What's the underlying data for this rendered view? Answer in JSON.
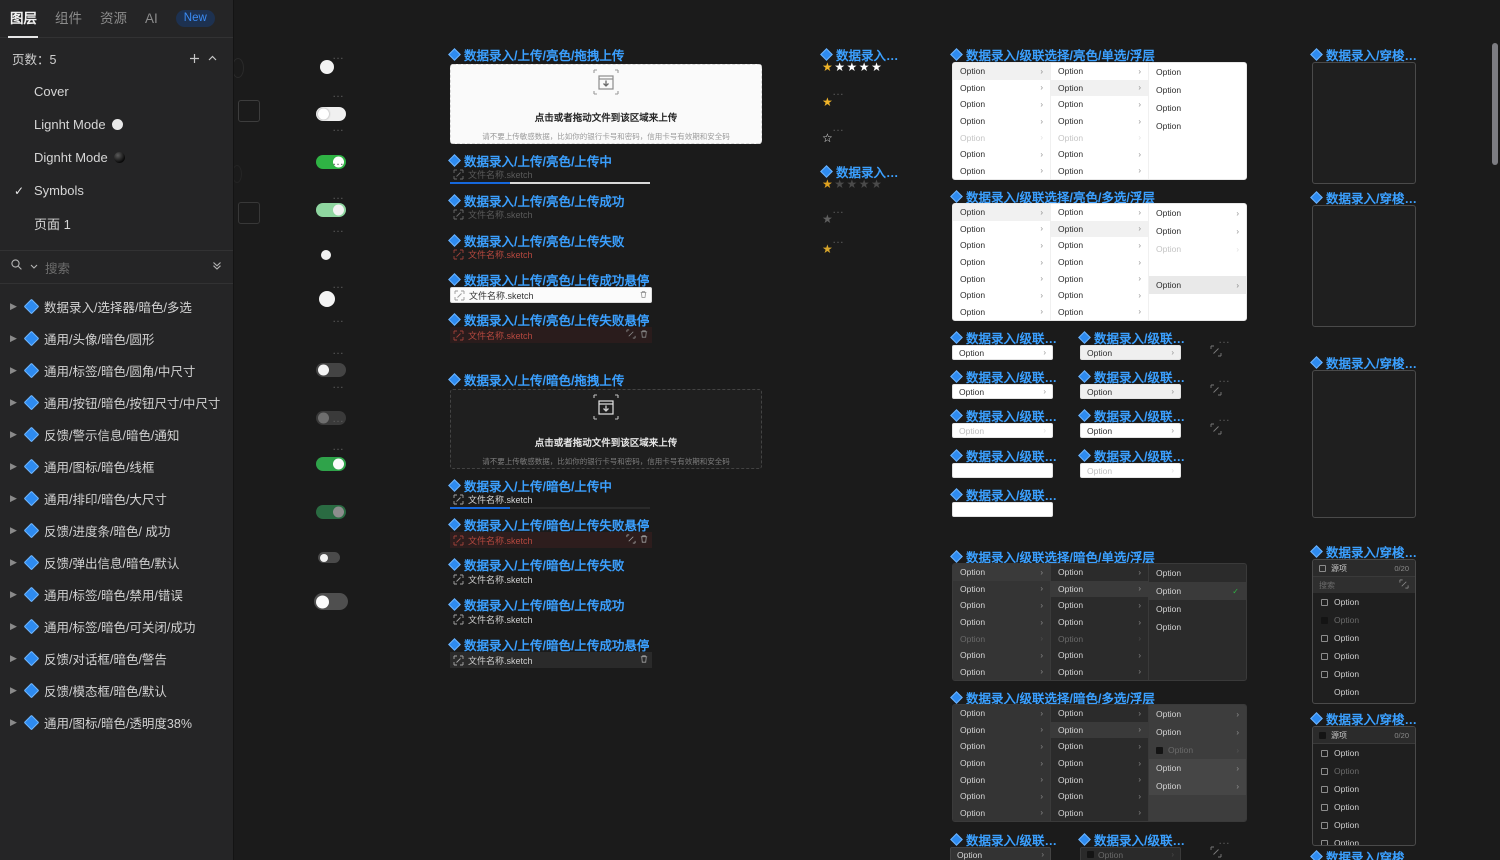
{
  "sidebar": {
    "tabs": [
      {
        "label": "图层",
        "active": true
      },
      {
        "label": "组件",
        "active": false
      },
      {
        "label": "资源",
        "active": false
      },
      {
        "label": "AI",
        "active": false
      }
    ],
    "badge_new": "New",
    "pages_label": "页数：5",
    "add_icon": "plus-icon",
    "collapse_icon": "chevron-up-icon",
    "pages": [
      {
        "label": "Cover",
        "checked": false,
        "dot": ""
      },
      {
        "label": "Lignht Mode",
        "checked": false,
        "dot": "light"
      },
      {
        "label": "Dignht Mode",
        "checked": false,
        "dot": "dark"
      },
      {
        "label": "Symbols",
        "checked": true,
        "dot": ""
      },
      {
        "label": "页面 1",
        "checked": false,
        "dot": ""
      }
    ],
    "search": {
      "placeholder": "搜索",
      "icon": "search-icon",
      "filter_icon": "chevron-down-icon",
      "expand_icon": "double-chevron-down-icon"
    },
    "symbols": [
      "数据录入/选择器/暗色/多选",
      "通用/头像/暗色/圆形",
      "通用/标签/暗色/圆角/中尺寸",
      "通用/按钮/暗色/按钮尺寸/中尺寸",
      "反馈/警示信息/暗色/通知",
      "通用/图标/暗色/线框",
      "通用/排印/暗色/大尺寸",
      "反馈/进度条/暗色/ 成功",
      "反馈/弹出信息/暗色/默认",
      "通用/标签/暗色/禁用/错误",
      "通用/标签/暗色/可关闭/成功",
      "反馈/对话框/暗色/警告",
      "反馈/模态框/暗色/默认",
      "通用/图标/暗色/透明度38%"
    ]
  },
  "canvas": {
    "colors": {
      "title_blue": "#3ba0ff",
      "accent_blue": "#1668dc",
      "success_green": "#2fb344",
      "error_red": "#c4443a",
      "star_gold": "#f0b429"
    },
    "toggles": [
      {
        "state": "off-light",
        "dots": "…"
      },
      {
        "state": "off-light-wide",
        "dots": "…"
      },
      {
        "state": "on-green",
        "dots": "…"
      },
      {
        "state": "on-green-dim",
        "dots": "…"
      },
      {
        "state": "off-small",
        "dots": "…"
      },
      {
        "state": "off-plain",
        "dots": "…"
      },
      {
        "state": "off-dark",
        "dots": "…"
      },
      {
        "state": "off-dark-dim",
        "dots": "…"
      },
      {
        "state": "on-dark-green",
        "dots": "…"
      },
      {
        "state": "on-dark-green-dim",
        "dots": "…"
      },
      {
        "state": "off-dark-small",
        "dots": "…"
      },
      {
        "state": "off-dark-wide",
        "dots": "…"
      }
    ],
    "upload_light": {
      "group_titles": [
        "数据录入/上传/亮色/拖拽上传",
        "数据录入/上传/亮色/上传中",
        "数据录入/上传/亮色/上传成功",
        "数据录入/上传/亮色/上传失败",
        "数据录入/上传/亮色/上传成功悬停",
        "数据录入/上传/亮色/上传失败悬停"
      ],
      "drop_icon": "upload-box-icon",
      "drop_main": "点击或者拖动文件到该区域来上传",
      "drop_sub": "请不要上传敏感数据，比如你的银行卡号和密码，信用卡号有效期和安全码",
      "file_name": "文件名称.sketch",
      "progress_percent": 30,
      "delete_icon": "trash-icon",
      "retry_icon": "retry-icon"
    },
    "upload_dark": {
      "group_titles": [
        "数据录入/上传/暗色/拖拽上传",
        "数据录入/上传/暗色/上传中",
        "数据录入/上传/暗色/上传失败悬停",
        "数据录入/上传/暗色/上传失败",
        "数据录入/上传/暗色/上传成功",
        "数据录入/上传/暗色/上传成功悬停"
      ],
      "drop_icon": "upload-box-icon",
      "drop_main": "点击或者拖动文件到该区域来上传",
      "drop_sub": "请不要上传敏感数据，比如你的银行卡号和密码，信用卡号有效期和安全码",
      "file_name": "文件名称.sketch",
      "progress_percent": 30,
      "delete_icon": "trash-icon",
      "retry_icon": "retry-icon"
    },
    "rates": [
      {
        "title": "数据录入…",
        "filled": 1,
        "total": 5,
        "style": "bright",
        "sub": [
          {
            "dots": "…",
            "icon": "star-gold-icon"
          },
          {
            "dots": "…",
            "icon": "star-outline-icon"
          }
        ]
      },
      {
        "title": "数据录入…",
        "filled": 1,
        "total": 5,
        "style": "dim",
        "sub": [
          {
            "dots": "…",
            "icon": "star-dim-icon"
          },
          {
            "dots": "…",
            "icon": "star-gold-icon"
          }
        ]
      }
    ],
    "cascaders": [
      {
        "title": "数据录入/级联选择/亮色/单选/浮层",
        "theme": "light"
      },
      {
        "title": "数据录入/级联选择/亮色/多选/浮层",
        "theme": "light"
      },
      {
        "title": "数据录入/级联选择/暗色/单选/浮层",
        "theme": "dark"
      },
      {
        "title": "数据录入/级联选择/暗色/多选/浮层",
        "theme": "dark"
      }
    ],
    "cascader_option": "Option",
    "small_cascaders_light": [
      {
        "title": "数据录入/级联…",
        "value": "Option",
        "variant": "light"
      },
      {
        "title": "数据录入/级联…",
        "value": "Option",
        "variant": "light"
      },
      {
        "title": "数据录入/级联…",
        "value": "Option",
        "variant": "lightg"
      },
      {
        "title": "数据录入/级联…",
        "value": "Option",
        "variant": "lightd"
      },
      {
        "title": "数据录入/级联…",
        "value": "",
        "variant": "light"
      },
      {
        "title": "数据录入/级联…",
        "value": "Option",
        "variant": "lightg"
      },
      {
        "title": "数据录入/级联…",
        "value": "",
        "variant": "light"
      },
      {
        "title": "数据录入/级联…",
        "value": "Option",
        "variant": "lightd"
      },
      {
        "title": "数据录入/级联…",
        "value": "",
        "variant": "light"
      }
    ],
    "small_cascaders_dark": [
      {
        "title": "数据录入/级联…",
        "value": "Option",
        "variant": "dark"
      },
      {
        "title": "数据录入/级联…",
        "value": "Option",
        "variant": "darkd"
      }
    ],
    "swap_icon": "swap-icon",
    "transfers_empty": [
      {
        "title": "数据录入/穿梭…"
      },
      {
        "title": "数据录入/穿梭…"
      },
      {
        "title": "数据录入/穿梭…"
      }
    ],
    "transfers": [
      {
        "title": "数据录入/穿梭…",
        "head_label": "源项",
        "count": "0/20",
        "search_placeholder": "搜索",
        "search_icon": "swap-icon",
        "rows": [
          {
            "label": "Option",
            "checked": false,
            "dim": false,
            "box": true
          },
          {
            "label": "Option",
            "checked": true,
            "dim": true,
            "box": true
          },
          {
            "label": "Option",
            "checked": false,
            "dim": false,
            "box": true
          },
          {
            "label": "Option",
            "checked": false,
            "dim": false,
            "box": true
          },
          {
            "label": "Option",
            "checked": false,
            "dim": false,
            "box": true
          },
          {
            "label": "Option",
            "checked": false,
            "dim": false,
            "box": false
          }
        ]
      },
      {
        "title": "数据录入/穿梭…",
        "head_label": "源项",
        "count": "0/20",
        "rows": [
          {
            "label": "Option",
            "checked": false,
            "dim": false,
            "box": true
          },
          {
            "label": "Option",
            "checked": false,
            "dim": true,
            "box": true
          },
          {
            "label": "Option",
            "checked": false,
            "dim": false,
            "box": true
          },
          {
            "label": "Option",
            "checked": false,
            "dim": false,
            "box": true
          },
          {
            "label": "Option",
            "checked": false,
            "dim": false,
            "box": true
          },
          {
            "label": "Option",
            "checked": false,
            "dim": false,
            "box": true
          }
        ]
      },
      {
        "title": "数据录入/穿梭…"
      }
    ]
  }
}
